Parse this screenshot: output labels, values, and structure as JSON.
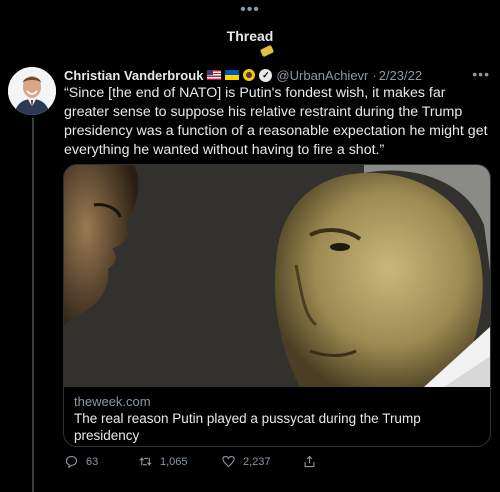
{
  "header": {
    "more_icon": "ellipsis-icon",
    "title": "Thread"
  },
  "tweet": {
    "author_name": "Christian Vanderbrouk",
    "emoji": [
      "us-flag",
      "ukraine-flag",
      "sunflower",
      "verified-badge"
    ],
    "handle": "@UrbanAchievr",
    "separator": "·",
    "date": "2/23/22",
    "text": "“Since [the end of NATO] is Putin's fondest wish, it makes far greater sense to suppose his relative restraint during the Trump presidency was a function of a reasonable expectation he might get everything he wanted without having to fire a shot.”"
  },
  "card": {
    "domain": "theweek.com",
    "title": "The real reason Putin played a pussycat during the Trump presidency"
  },
  "actions": {
    "replies": "63",
    "retweets": "1,065",
    "likes": "2,237"
  },
  "colors": {
    "background": "#000000",
    "text": "#e7e9ea",
    "muted": "#8b98a5",
    "border": "#2f3336"
  }
}
